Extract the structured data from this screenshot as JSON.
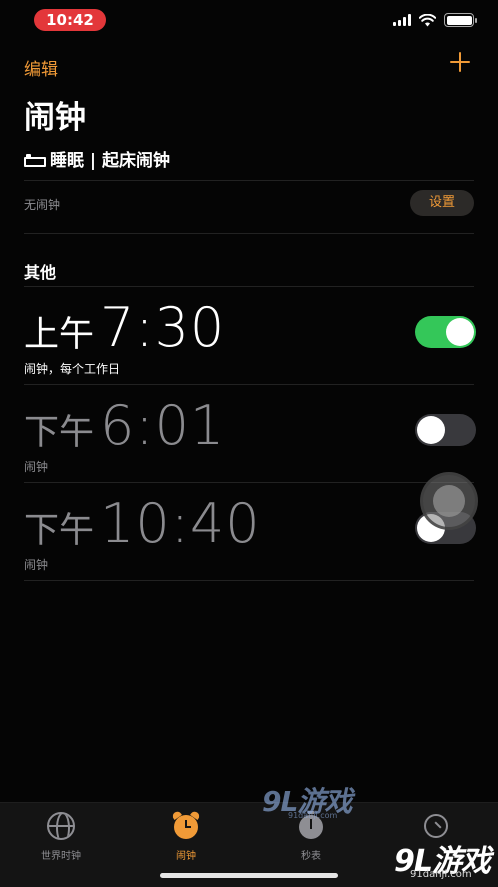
{
  "status_bar": {
    "time": "10:42"
  },
  "nav": {
    "edit_label": "编辑",
    "title": "闹钟"
  },
  "sleep": {
    "header": "睡眠 | 起床闹钟",
    "empty_label": "无闹钟",
    "setup_label": "设置"
  },
  "other": {
    "header": "其他"
  },
  "alarms": [
    {
      "period": "上午",
      "time": "7:30",
      "label": "闹钟，每个工作日",
      "enabled": true
    },
    {
      "period": "下午",
      "time": "6:01",
      "label": "闹钟",
      "enabled": false
    },
    {
      "period": "下午",
      "time": "10:40",
      "label": "闹钟",
      "enabled": false
    }
  ],
  "tabs": [
    {
      "label": "世界时钟",
      "icon": "globe-icon",
      "active": false
    },
    {
      "label": "闹钟",
      "icon": "alarm-clock-icon",
      "active": true
    },
    {
      "label": "秒表",
      "icon": "stopwatch-icon",
      "active": false
    },
    {
      "label": "",
      "icon": "timer-icon",
      "active": false
    }
  ],
  "watermark": {
    "text": "9L游戏",
    "sub": "91danji.com"
  },
  "corner_watermark": {
    "text": "9L游戏",
    "sub": "91danji.com"
  },
  "colors": {
    "accent": "#f09a37",
    "toggle_on": "#34c759",
    "toggle_off": "#39393d",
    "status_pill": "#e3373a"
  }
}
